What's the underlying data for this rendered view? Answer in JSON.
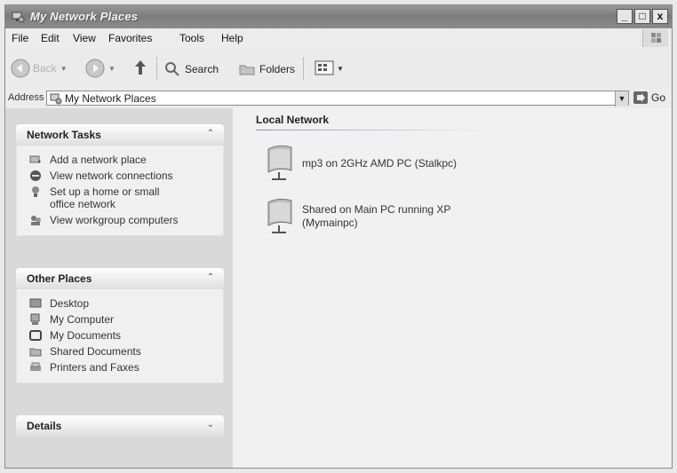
{
  "window": {
    "title": "My Network Places",
    "controls": {
      "minimize": "_",
      "maximize": "□",
      "close": "x"
    }
  },
  "menu": [
    "File",
    "Edit",
    "View",
    "Favorites",
    "Tools",
    "Help"
  ],
  "toolbar": {
    "back": "Back",
    "search": "Search",
    "folders": "Folders"
  },
  "address": {
    "label": "Address",
    "value": "My Network Places",
    "go": "Go"
  },
  "tasks_panel": {
    "title": "Network Tasks",
    "items": [
      {
        "label": "Add a network place",
        "icon": "add-network-place-icon"
      },
      {
        "label": "View network connections",
        "icon": "network-connections-icon"
      },
      {
        "label": "Set up a home or small office network",
        "icon": "setup-network-icon"
      },
      {
        "label": "View workgroup computers",
        "icon": "workgroup-icon"
      }
    ]
  },
  "places_panel": {
    "title": "Other Places",
    "items": [
      {
        "label": "Desktop",
        "icon": "desktop-icon"
      },
      {
        "label": "My Computer",
        "icon": "my-computer-icon"
      },
      {
        "label": "My Documents",
        "icon": "my-documents-icon"
      },
      {
        "label": "Shared Documents",
        "icon": "shared-documents-icon"
      },
      {
        "label": "Printers and Faxes",
        "icon": "printers-icon"
      }
    ]
  },
  "details_panel": {
    "title": "Details"
  },
  "local_network": {
    "heading": "Local Network",
    "items": [
      {
        "label": "mp3 on 2GHz AMD PC (Stalkpc)"
      },
      {
        "label": "Shared on Main PC running XP (Mymainpc)"
      }
    ]
  },
  "colors": {
    "titlebar": "#8a8a8a",
    "left_pane": "#d9d9d9",
    "panel_body": "#f0f0f0"
  }
}
